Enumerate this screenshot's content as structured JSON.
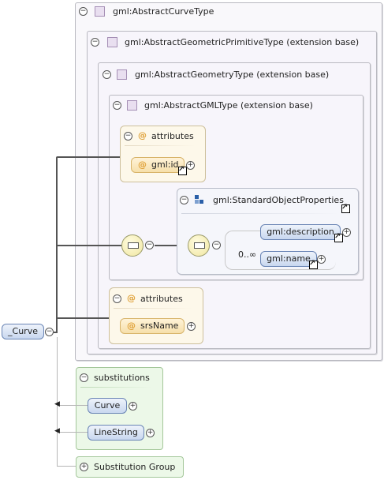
{
  "diagram": {
    "root_element": "_Curve",
    "types": {
      "curve": "gml:AbstractCurveType",
      "geometric_primitive": "gml:AbstractGeometricPrimitiveType (extension base)",
      "geometry": "gml:AbstractGeometryType (extension base)",
      "gml": "gml:AbstractGMLType (extension base)"
    },
    "attributes_top": {
      "label": "attributes",
      "items": [
        "gml:id"
      ]
    },
    "standard_object_properties": {
      "label": "gml:StandardObjectProperties",
      "elements": [
        "gml:description",
        "gml:name"
      ],
      "cardinality": "0..∞"
    },
    "attributes_bottom": {
      "label": "attributes",
      "items": [
        "srsName"
      ]
    },
    "substitutions": {
      "label": "substitutions",
      "items": [
        "Curve",
        "LineString"
      ]
    },
    "substitution_group": "Substitution Group",
    "icons": {
      "collapse": "⊖",
      "expand": "⊕"
    }
  }
}
